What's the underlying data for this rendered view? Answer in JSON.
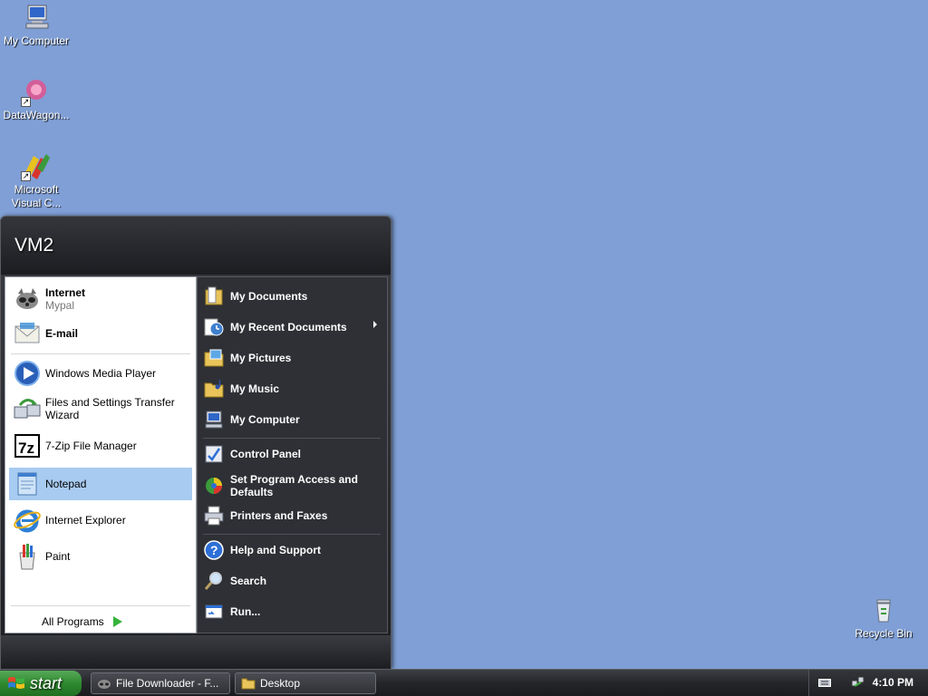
{
  "desktop": {
    "icons": [
      {
        "label": "My Computer",
        "icon": "my-computer-icon"
      },
      {
        "label": "DataWagon...",
        "icon": "datawagon-icon"
      },
      {
        "label": "Microsoft Visual C...",
        "icon": "visual-c-icon"
      },
      {
        "label": "Recycle Bin",
        "icon": "recycle-bin-icon"
      }
    ]
  },
  "start_menu": {
    "user_name": "VM2",
    "pinned": [
      {
        "title": "Internet",
        "subtitle": "Mypal",
        "icon": "mypal-icon"
      },
      {
        "title": "E-mail",
        "subtitle": "",
        "icon": "email-icon"
      }
    ],
    "recent": [
      {
        "label": "Windows Media Player",
        "icon": "media-player-icon"
      },
      {
        "label": "Files and Settings Transfer Wizard",
        "icon": "transfer-wizard-icon"
      },
      {
        "label": "7-Zip File Manager",
        "icon": "7zip-icon"
      },
      {
        "label": "Notepad",
        "icon": "notepad-icon",
        "selected": true
      },
      {
        "label": "Internet Explorer",
        "icon": "internet-explorer-icon"
      },
      {
        "label": "Paint",
        "icon": "paint-icon"
      }
    ],
    "all_programs_label": "All Programs",
    "places": [
      {
        "label": "My Documents",
        "icon": "my-documents-icon"
      },
      {
        "label": "My Recent Documents",
        "icon": "recent-documents-icon",
        "submenu": true
      },
      {
        "label": "My Pictures",
        "icon": "my-pictures-icon"
      },
      {
        "label": "My Music",
        "icon": "my-music-icon"
      },
      {
        "label": "My Computer",
        "icon": "my-computer-icon"
      },
      {
        "label": "Control Panel",
        "icon": "control-panel-icon"
      },
      {
        "label": "Set Program Access and Defaults",
        "icon": "program-access-icon"
      },
      {
        "label": "Printers and Faxes",
        "icon": "printer-icon"
      },
      {
        "label": "Help and Support",
        "icon": "help-icon"
      },
      {
        "label": "Search",
        "icon": "search-icon"
      },
      {
        "label": "Run...",
        "icon": "run-icon"
      }
    ]
  },
  "taskbar": {
    "start_label": "start",
    "tasks": [
      {
        "label": "File Downloader - F...",
        "icon": "file-downloader-icon"
      },
      {
        "label": "Desktop",
        "icon": "folder-icon"
      }
    ],
    "clock": "4:10 PM"
  },
  "colors": {
    "desktop_bg": "#7f9fd6",
    "selected_item": "#a8cbf1",
    "start_green": "#2f8a2f"
  }
}
